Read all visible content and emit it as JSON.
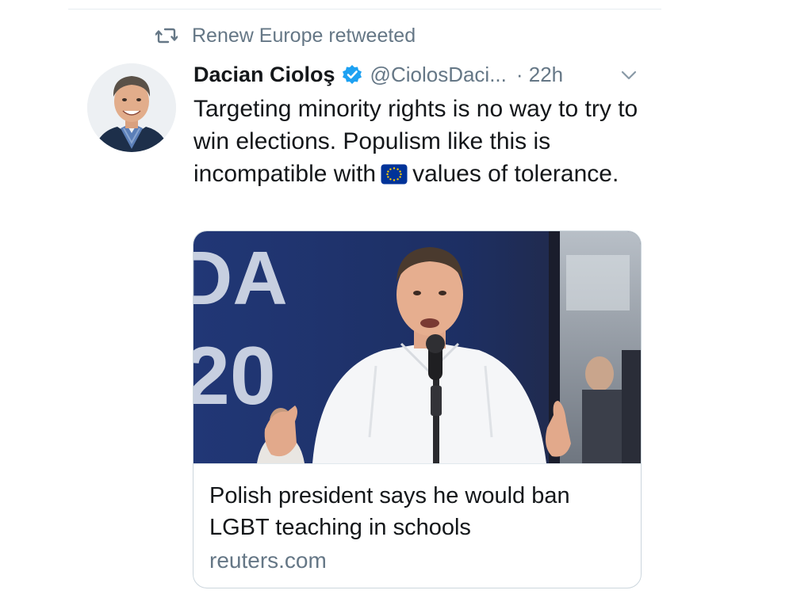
{
  "retweet_context": {
    "label": "Renew Europe retweeted"
  },
  "tweet": {
    "author_name": "Dacian Cioloş",
    "handle": "@CiolosDaci...",
    "time": "· 22h",
    "text_before_flag": "Targeting minority rights is no way to try to win elections. Populism like this is incompatible with",
    "text_after_flag": "values of tolerance."
  },
  "link_card": {
    "image_backdrop_text_top": "DA",
    "image_backdrop_text_bottom": "20",
    "title": "Polish president says he would ban LGBT teaching in schools",
    "domain": "reuters.com"
  },
  "icons": {
    "retweet": "retweet-icon",
    "verified": "verified-badge-icon",
    "more": "chevron-down-icon",
    "flag": "eu-flag-emoji"
  },
  "colors": {
    "secondary_text": "#657786",
    "verified_blue": "#1da1f2",
    "divider": "#e6ecf0",
    "eu_blue": "#003399",
    "eu_yellow": "#ffcc00"
  }
}
